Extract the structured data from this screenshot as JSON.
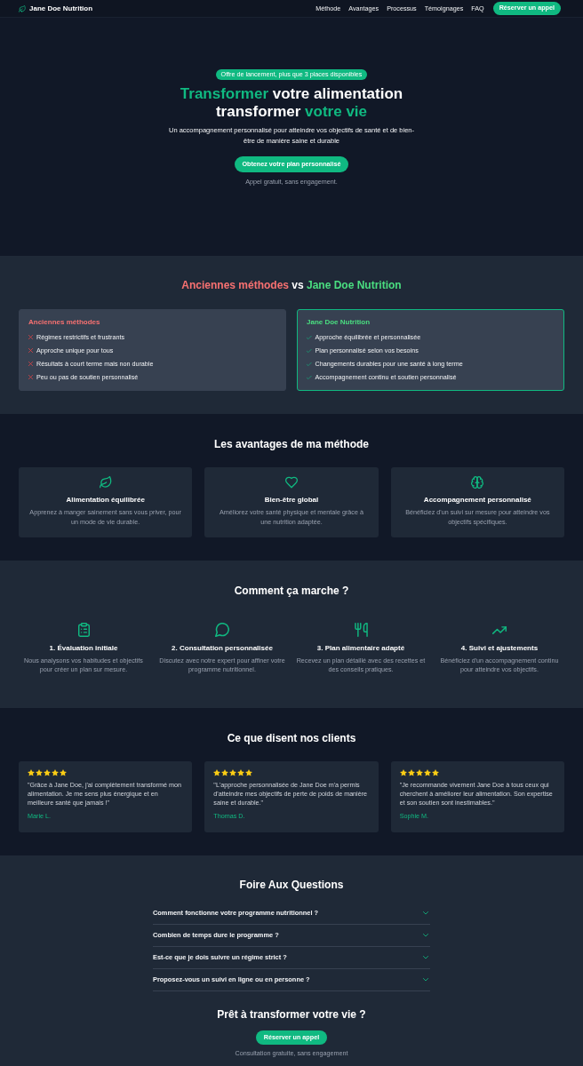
{
  "header": {
    "brand": "Jane Doe Nutrition",
    "nav": [
      "Méthode",
      "Avantages",
      "Processus",
      "Témoignages",
      "FAQ"
    ],
    "cta": "Réserver un appel"
  },
  "hero": {
    "badge": "Offre de lancement, plus que 3 places disponibles",
    "title": [
      [
        {
          "text": "Transformer",
          "kind": "accent"
        },
        {
          "text": " votre alimentation",
          "kind": "plain"
        }
      ],
      [
        {
          "text": "transformer ",
          "kind": "plain"
        },
        {
          "text": "votre vie",
          "kind": "accent"
        }
      ]
    ],
    "subtitle": "Un accompagnement personnalisé pour atteindre vos objectifs de santé et de bien-être de manière saine et durable",
    "button": "Obtenez votre plan personnalisé",
    "note": "Appel gratuit, sans engagement."
  },
  "comparison": {
    "title": [
      {
        "text": "Anciennes méthodes",
        "kind": "old"
      },
      {
        "text": " vs ",
        "kind": "plain"
      },
      {
        "text": "Jane Doe Nutrition",
        "kind": "new"
      }
    ],
    "columns": [
      {
        "kind": "old",
        "title": "Anciennes méthodes",
        "items": [
          "Régimes restrictifs et frustrants",
          "Approche unique pour tous",
          "Résultats à court terme mais non durable",
          "Peu ou pas de soutien personnalisé"
        ]
      },
      {
        "kind": "new",
        "title": "Jane Doe Nutrition",
        "items": [
          "Approche équilibrée et personnalisée",
          "Plan personnalisé selon vos besoins",
          "Changements durables pour une santé à long terme",
          "Accompagnement continu et soutien personnalisé"
        ]
      }
    ]
  },
  "advantages": {
    "title": "Les avantages de ma méthode",
    "cards": [
      {
        "title": "Alimentation équilibrée",
        "text": "Apprenez à manger sainement sans vous priver, pour un mode de vie durable."
      },
      {
        "title": "Bien-être global",
        "text": "Améliorez votre santé physique et mentale grâce à une nutrition adaptée."
      },
      {
        "title": "Accompagnement personnalisé",
        "text": "Bénéficiez d'un suivi sur mesure pour atteindre vos objectifs spécifiques."
      }
    ]
  },
  "process": {
    "title": "Comment ça marche ?",
    "steps": [
      {
        "title": "1. Évaluation initiale",
        "text": "Nous analysons vos habitudes et objectifs pour créer un plan sur mesure."
      },
      {
        "title": "2. Consultation personnalisée",
        "text": "Discutez avec notre expert pour affiner votre programme nutritionnel."
      },
      {
        "title": "3. Plan alimentaire adapté",
        "text": "Recevez un plan détaillé avec des recettes et des conseils pratiques."
      },
      {
        "title": "4. Suivi et ajustements",
        "text": "Bénéficiez d'un accompagnement continu pour atteindre vos objectifs."
      }
    ]
  },
  "testimonials": {
    "title": "Ce que disent nos clients",
    "items": [
      {
        "stars": 5,
        "quote": "\"Grâce à Jane Doe, j'ai complètement transformé mon alimentation. Je me sens plus énergique et en meilleure santé que jamais !\"",
        "author": "Marie L."
      },
      {
        "stars": 5,
        "quote": "\"L'approche personnalisée de Jane Doe m'a permis d'atteindre mes objectifs de perte de poids de manière saine et durable.\"",
        "author": "Thomas D."
      },
      {
        "stars": 5,
        "quote": "\"Je recommande vivement Jane Doe à tous ceux qui cherchent à améliorer leur alimentation. Son expertise et son soutien sont inestimables.\"",
        "author": "Sophie M."
      }
    ]
  },
  "faq": {
    "title": "Foire Aux Questions",
    "items": [
      {
        "question": "Comment fonctionne votre programme nutritionnel ?",
        "expanded": false
      },
      {
        "question": "Combien de temps dure le programme ?",
        "expanded": false
      },
      {
        "question": "Est-ce que je dois suivre un régime strict ?",
        "expanded": false
      },
      {
        "question": "Proposez-vous un suivi en ligne ou en personne ?",
        "expanded": false
      }
    ]
  },
  "cta": {
    "title": "Prêt à transformer votre vie ?",
    "button": "Réserver un appel",
    "note": "Consultation gratuite, sans engagement"
  }
}
